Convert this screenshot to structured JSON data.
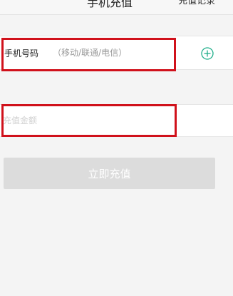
{
  "header": {
    "title": "手机充值",
    "recharge_record": "充值记录"
  },
  "phone_row": {
    "label": "手机号码",
    "placeholder": "（移动/联通/电信）",
    "add_icon": "plus-circle-icon",
    "icon_color": "#1fae8a"
  },
  "amount_row": {
    "placeholder": "充值金额"
  },
  "submit": {
    "label": "立即充值",
    "background": "#dcdcdc"
  },
  "highlight_color": "#d0111b"
}
